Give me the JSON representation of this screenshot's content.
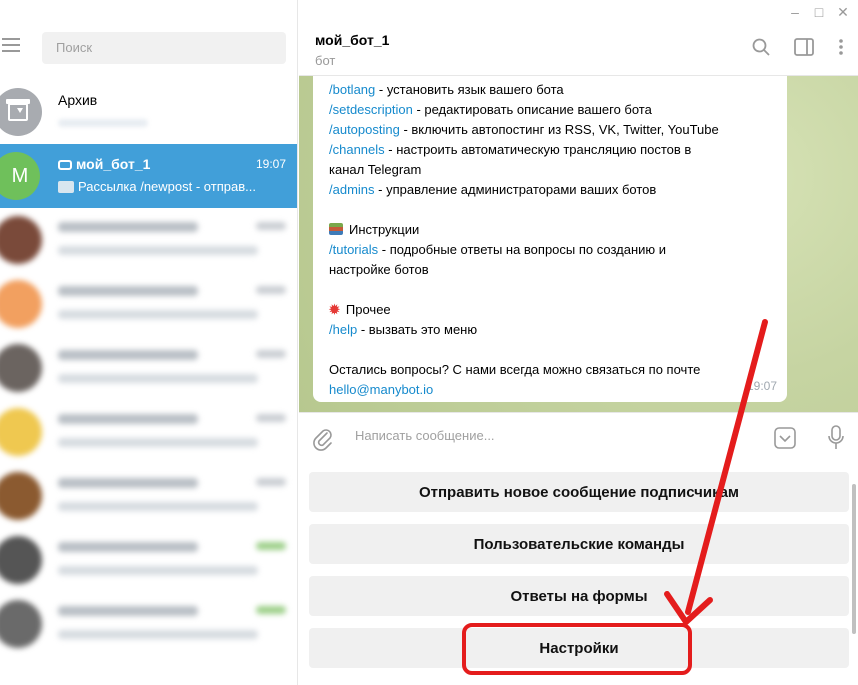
{
  "window": {
    "controls": [
      "–",
      "□",
      "✕"
    ]
  },
  "sidebar": {
    "search_placeholder": "Поиск",
    "archive": {
      "name": "Архив",
      "preview": ""
    },
    "selected_chat": {
      "avatar_letter": "M",
      "name": "мой_бот_1",
      "time": "19:07",
      "preview": "Рассылка /newpost - отправ..."
    },
    "blurred_chat_count": 7
  },
  "chat": {
    "title": "мой_бот_1",
    "subtitle": "бот",
    "message": {
      "lines": [
        {
          "cmd": "/botlang",
          "text": " - установить язык вашего бота"
        },
        {
          "cmd": "/setdescription",
          "text": " - редактировать описание вашего бота"
        },
        {
          "cmd": "/autoposting",
          "text": " - включить автопостинг из RSS, VK, Twitter, YouTube"
        },
        {
          "cmd": "/channels",
          "text": " - настроить автоматическую трансляцию постов в"
        },
        {
          "cmd": "",
          "text": "канал Telegram"
        },
        {
          "cmd": "/admins",
          "text": " - управление администраторами ваших ботов"
        }
      ],
      "instructions_heading": "Инструкции",
      "tutorials_cmd": "/tutorials",
      "tutorials_text": " - подробные ответы на вопросы по созданию и",
      "tutorials_text2": "настройке ботов",
      "other_heading": "Прочее",
      "help_cmd": "/help",
      "help_text": " - вызвать это меню",
      "contact_text": "Остались вопросы? С нами всегда можно связаться по почте",
      "email": "hello@manybot.io",
      "time": "19:07"
    },
    "input_placeholder": "Написать сообщение..."
  },
  "keyboard": {
    "buttons": [
      "Отправить новое сообщение подписчикам",
      "Пользовательские команды",
      "Ответы на формы",
      "Настройки"
    ]
  },
  "colors": {
    "selected_chat": "#419fd9",
    "link": "#168acd",
    "annotation": "#e41c1c",
    "avatar": "#6fc05b"
  }
}
